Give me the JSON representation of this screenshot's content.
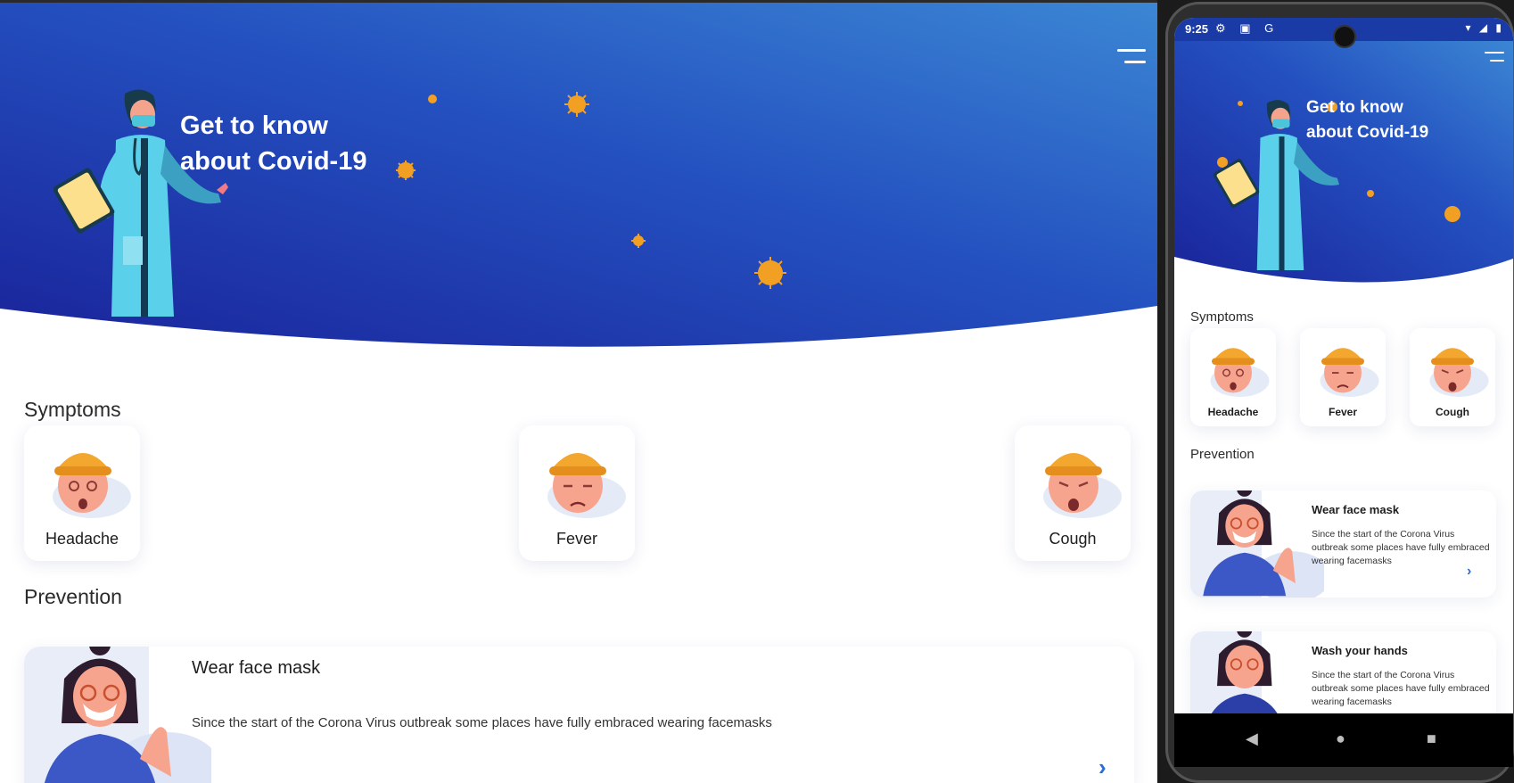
{
  "hero": {
    "title_line1": "Get to know",
    "title_line2": "about Covid-19"
  },
  "symptoms": {
    "heading": "Symptoms",
    "items": [
      {
        "label": "Headache"
      },
      {
        "label": "Fever"
      },
      {
        "label": "Cough"
      }
    ]
  },
  "prevention": {
    "heading": "Prevention",
    "items": [
      {
        "title": "Wear face mask",
        "text_desktop": "Since the start of the Corona Virus outbreak some places have fully embraced wearing facemasks",
        "text_phone": "Since the start of the Corona Virus outbreak some places have fully embraced wearing facemasks"
      },
      {
        "title": "Wash your hands",
        "text_phone": "Since the start of the Corona Virus outbreak some places have fully embraced wearing facemasks"
      }
    ]
  },
  "phone_status": {
    "time": "9:25",
    "left_icons": "⚙ ▣ G",
    "right_icons": "▾ ◢ ▮"
  },
  "nav": {
    "back": "◀",
    "home": "●",
    "recents": "■"
  },
  "colors": {
    "hero_start": "#1a2a9a",
    "hero_end": "#3b86d4",
    "virus": "#f2a024",
    "accent": "#2d6bd1"
  }
}
